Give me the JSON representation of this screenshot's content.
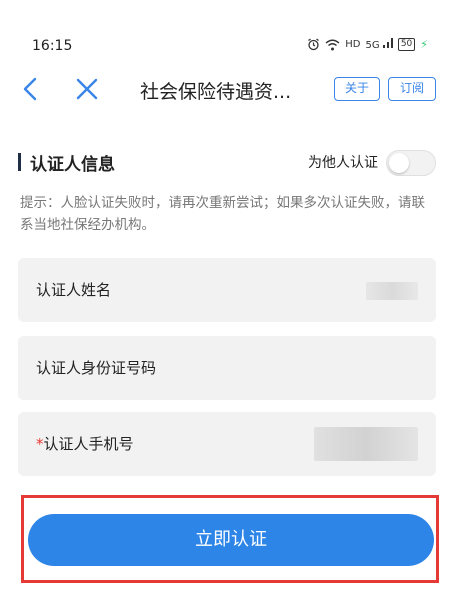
{
  "status_bar": {
    "time": "16:15",
    "icons": [
      "alarm-icon",
      "wifi-icon",
      "hd-icon",
      "signal-icon",
      "battery-icon"
    ],
    "hd_text": "HD",
    "signal_text": "5G",
    "battery_text": "50"
  },
  "nav": {
    "title": "社会保险待遇资...",
    "about_label": "关于",
    "subscribe_label": "订阅"
  },
  "section": {
    "title": "认证人信息",
    "toggle_label": "为他人认证",
    "toggle_on": false
  },
  "hint": "提示：人脸认证失败时，请再次重新尝试；如果多次认证失败，请联系当地社保经办机构。",
  "fields": [
    {
      "label": "认证人姓名",
      "required": false
    },
    {
      "label": "认证人身份证号码",
      "required": false
    },
    {
      "label": "认证人手机号",
      "required": true,
      "required_mark": "*"
    }
  ],
  "submit_label": "立即认证",
  "colors": {
    "accent": "#2d85e8",
    "highlight": "#e53935",
    "field_bg": "#f2f2f2"
  }
}
